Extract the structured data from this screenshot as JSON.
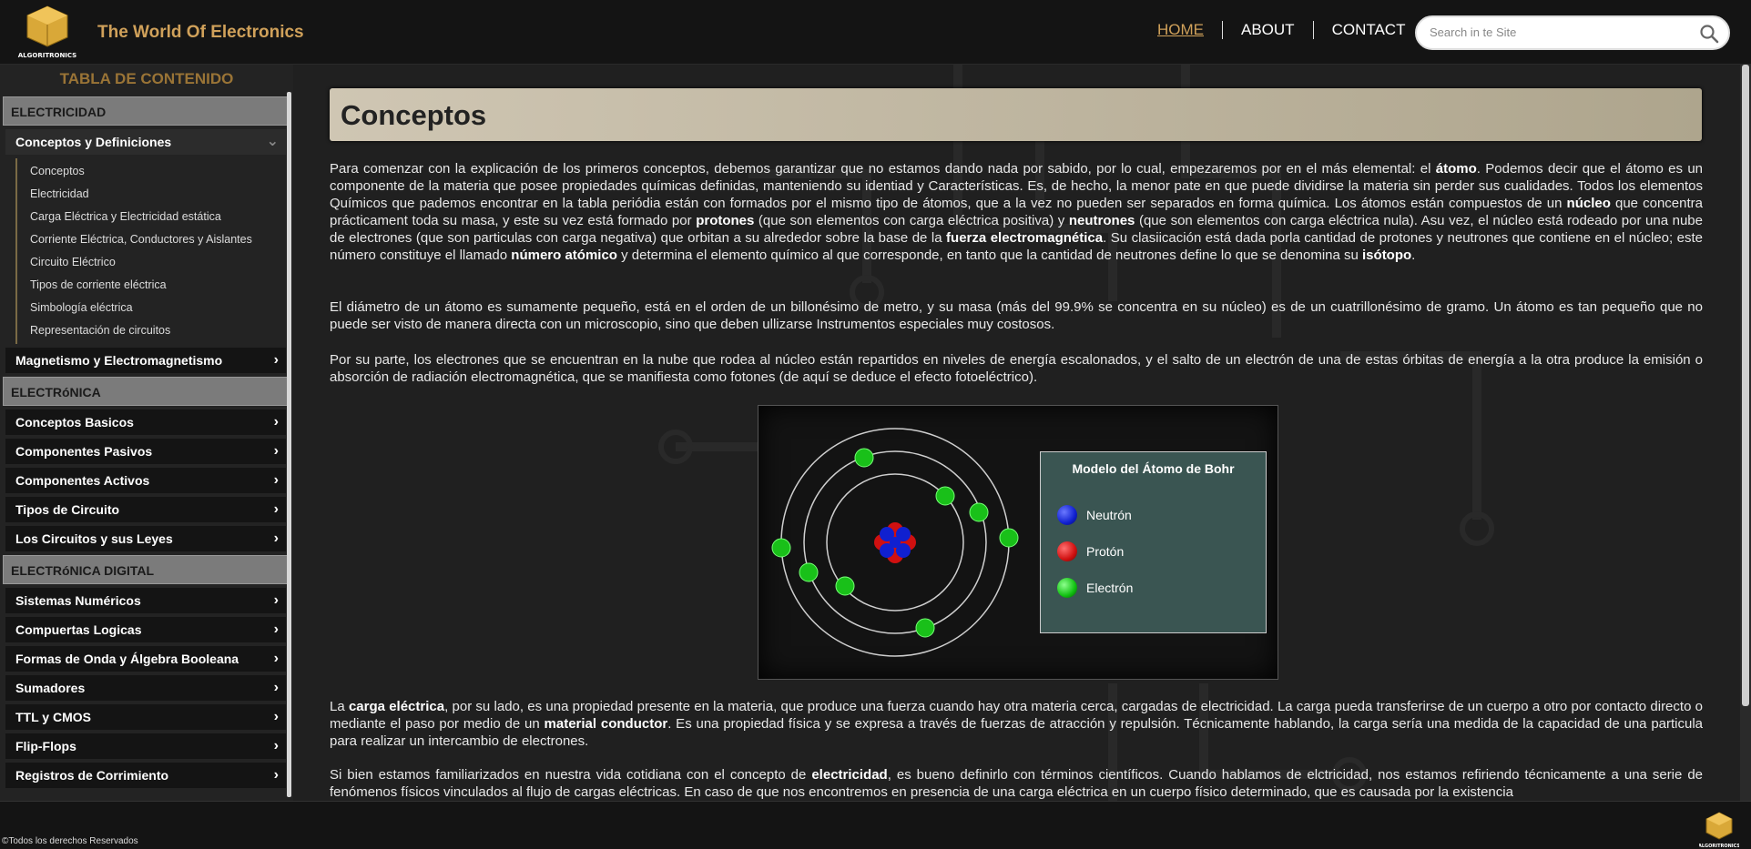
{
  "header": {
    "logo_text": "ALGORITRONICS",
    "site_title": "The World Of Electronics",
    "nav": [
      "HOME",
      "ABOUT",
      "CONTACT"
    ],
    "search_placeholder": "Search in te Site",
    "accent": "#d0a15a"
  },
  "sidebar": {
    "title": "TABLA DE CONTENIDO",
    "sections": {
      "electricidad": "ELECTRICIDAD",
      "electronica": "ELECTRóNICA",
      "electronica_digital": "ELECTRóNICA DIGITAL"
    },
    "open_item": "Conceptos y Definiciones",
    "sub_items": [
      "Conceptos",
      "Electricidad",
      "Carga Eléctrica y Electricidad estática",
      "Corriente Eléctrica, Conductores y Aislantes",
      "Circuito Eléctrico",
      "Tipos de corriente eléctrica",
      "Simbología eléctrica",
      "Representación de circuitos"
    ],
    "electricidad_items": [
      "Magnetismo y Electromagnetismo"
    ],
    "electronica_items": [
      "Conceptos Basicos",
      "Componentes Pasivos",
      "Componentes Activos",
      "Tipos de Circuito",
      "Los Circuitos y sus Leyes"
    ],
    "digital_items": [
      "Sistemas Numéricos",
      "Compuertas Logicas",
      "Formas de Onda y Álgebra Booleana",
      "Sumadores",
      "TTL y CMOS",
      "Flip-Flops",
      "Registros de Corrimiento"
    ]
  },
  "main": {
    "title": "Conceptos",
    "p1": {
      "t1": "Para comenzar con la explicación de los primeros conceptos, debemos garantizar que no estamos dando nada por sabido, por lo cual, empezaremos por en el más elemental: el ",
      "b1": "átomo",
      "t2": ". Podemos decir que el átomo es un componente de la materia que posee propiedades químicas definidas, manteniendo su identiad y Características. Es, de hecho, la menor pate en que puede dividirse la materia sin perder sus cualidades. Todos los elementos Químicos que pademos encontrar en la tabla periódia están con formados por el mismo tipo de átomos, que a la vez no pueden ser separados en forma química. Los átomos están compuestos de un ",
      "b2": "núcleo",
      "t3": " que concentra prácticament toda su masa, y este su vez está formado por ",
      "b3": "protones",
      "t4": " (que son elementos con carga eléctrica positiva) y ",
      "b4": "neutrones",
      "t5": " (que son elementos con carga eléctrica nula). Asu vez, el núcleo está rodeado por una nube de electrones (que son particulas con carga negativa) que orbitan a su alrededor sobre la base de la ",
      "b5": "fuerza electromagnética",
      "t6": ". Su clasiicación está dada porla cantidad de protones y neutrones que contiene en el núcleo; este número constituye el llamado ",
      "b6": "número atómico",
      "t7": " y determina el elemento químico al que corresponde, en tanto que la cantidad de neutrones define lo que se denomina su ",
      "b7": "isótopo",
      "t8": "."
    },
    "p2": "El diámetro de un átomo es sumamente pequeño, está en el orden de un billonésimo de metro, y su masa (más del 99.9% se concentra en su núcleo) es de un cuatrillonésimo de gramo. Un átomo es tan pequeño que no puede ser visto de manera directa con un microscopio, sino que deben ullizarse Instrumentos especiales muy costosos.",
    "p3": "Por su parte, los electrones que se encuentran en la nube que rodea al núcleo están repartidos en niveles de energía escalonados, y el salto de un electrón de una de estas órbitas de energía a la otra produce la emisión o absorción de radiación electromagnética, que se manifiesta como fotones (de aquí se deduce el efecto fotoeléctrico).",
    "figure": {
      "title": "Modelo del Átomo de Bohr",
      "legend": [
        {
          "label": "Neutrón",
          "color": "#1020d0"
        },
        {
          "label": "Protón",
          "color": "#d01010"
        },
        {
          "label": "Electrón",
          "color": "#10c010"
        }
      ]
    },
    "p4": {
      "t1": "La ",
      "b1": "carga eléctrica",
      "t2": ", por su lado, es una propiedad presente en la materia, que produce una fuerza cuando hay otra materia cerca, cargadas de electricidad. La carga pueda transferirse de un cuerpo a otro por contacto directo o mediante el paso por medio de un ",
      "b2": "material conductor",
      "t3": ". Es una propiedad física y se expresa a través de fuerzas de atracción y repulsión. Técnicamente hablando, la carga sería una medida de la capacidad de una particula para realizar un intercambio de electrones."
    },
    "p5": {
      "t1": "Si bien estamos familiarizados en nuestra vida cotidiana con el concepto de ",
      "b1": "electricidad",
      "t2": ", es bueno definirlo con términos científicos. Cuando hablamos de elctricidad, nos estamos refiriendo técnicamente a una serie de fenómenos físicos vinculados al flujo de cargas eléctricas. En caso de que nos encontremos en presencia de una carga eléctrica en un cuerpo físico determinado, que es causada por la existencia"
    }
  },
  "footer": {
    "copyright": "©Todos los derechos Reservados",
    "logo_text": "ALGORITRONICS"
  }
}
